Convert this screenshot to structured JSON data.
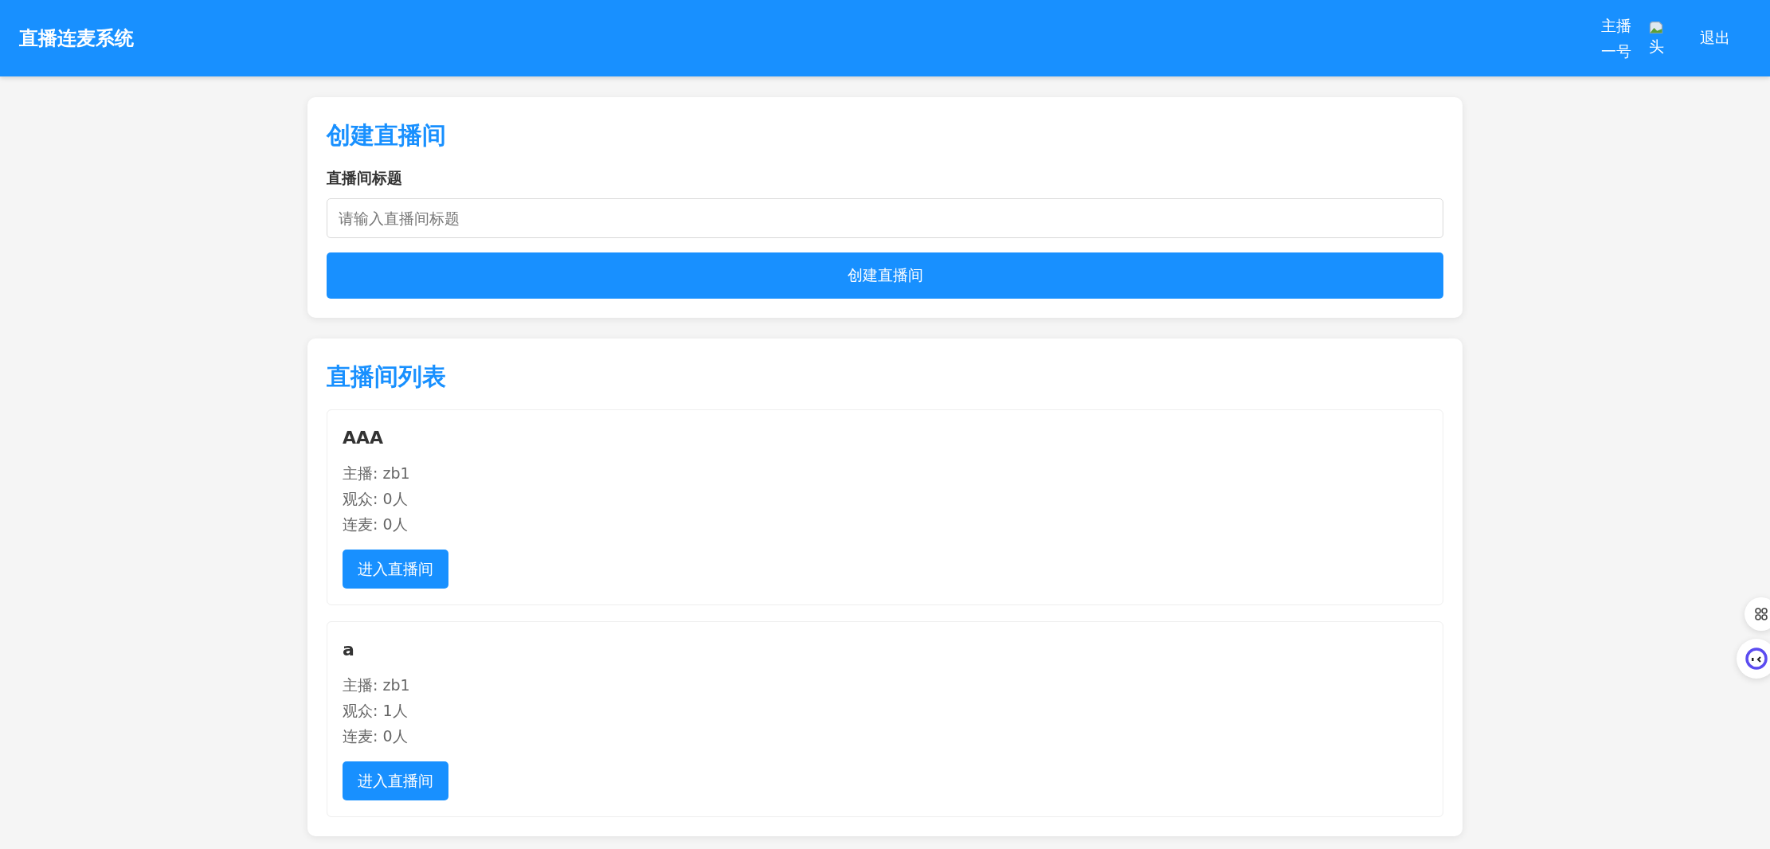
{
  "header": {
    "title": "直播连麦系统",
    "user": {
      "name": "主播一号",
      "avatar_alt": "头"
    },
    "logout": "退出"
  },
  "create_room": {
    "heading": "创建直播间",
    "label": "直播间标题",
    "placeholder": "请输入直播间标题",
    "button": "创建直播间"
  },
  "room_list": {
    "heading": "直播间列表",
    "rooms": [
      {
        "title": "AAA",
        "lines": [
          "主播: zb1",
          "观众: 0人",
          "连麦: 0人"
        ],
        "button": "进入直播间"
      },
      {
        "title": "a",
        "lines": [
          "主播: zb1",
          "观众: 1人",
          "连麦: 0人"
        ],
        "button": "进入直播间"
      }
    ]
  }
}
